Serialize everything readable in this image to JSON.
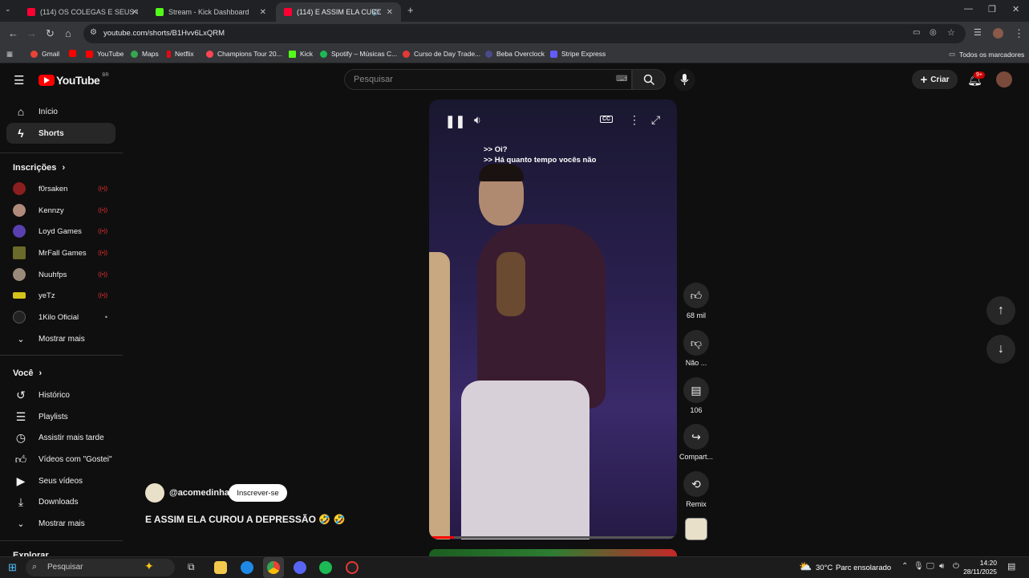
{
  "browser": {
    "tabs": [
      {
        "title": "(114) OS COLEGAS E SEUS CAR",
        "active": false
      },
      {
        "title": "Stream - Kick Dashboard",
        "active": false
      },
      {
        "title": "(114) E ASSIM ELA CUROU",
        "active": true
      }
    ],
    "url": "youtube.com/shorts/B1Hvv6LxQRM",
    "bookmarks": [
      "Gmail",
      "YouTube",
      "Maps",
      "Netflix",
      "Champions Tour 20...",
      "Kick",
      "Spotify – Músicas C...",
      "Curso de Day Trade...",
      "Beba Overclock",
      "Stripe Express"
    ],
    "all_bookmarks": "Todos os marcadores"
  },
  "youtube": {
    "logo_text": "YouTube",
    "region": "BR",
    "search_placeholder": "Pesquisar",
    "create_label": "Criar",
    "notifications_badge": "9+"
  },
  "sidebar": {
    "main": [
      {
        "label": "Início"
      },
      {
        "label": "Shorts"
      }
    ],
    "subs_title": "Inscrições",
    "subs": [
      {
        "label": "f0rsaken"
      },
      {
        "label": "Kennzy"
      },
      {
        "label": "Loyd Games"
      },
      {
        "label": "MrFall Games"
      },
      {
        "label": "Nuuhfps"
      },
      {
        "label": "yeTz"
      },
      {
        "label": "1Kilo Oficial"
      }
    ],
    "subs_more": "Mostrar mais",
    "you_title": "Você",
    "you": [
      {
        "label": "Histórico"
      },
      {
        "label": "Playlists"
      },
      {
        "label": "Assistir mais tarde"
      },
      {
        "label": "Vídeos com \"Gostei\""
      },
      {
        "label": "Seus vídeos"
      },
      {
        "label": "Downloads"
      }
    ],
    "you_more": "Mostrar mais",
    "explore_title": "Explorar"
  },
  "short": {
    "captions": [
      ">> Oi?",
      ">> Há quanto tempo vocês não"
    ],
    "channel": "@acomedinha",
    "subscribe_label": "Inscrever-se",
    "title": "E ASSIM ELA CUROU A DEPRESSÃO 🤣 🤣",
    "likes": "68 mil",
    "dislike_label": "Não ...",
    "comments": "106",
    "share_label": "Compart...",
    "remix_label": "Remix"
  },
  "taskbar": {
    "search_placeholder": "Pesquisar",
    "weather": "30°C",
    "weather_desc": "Parc ensolarado",
    "time": "14:20",
    "date": "28/11/2025"
  }
}
